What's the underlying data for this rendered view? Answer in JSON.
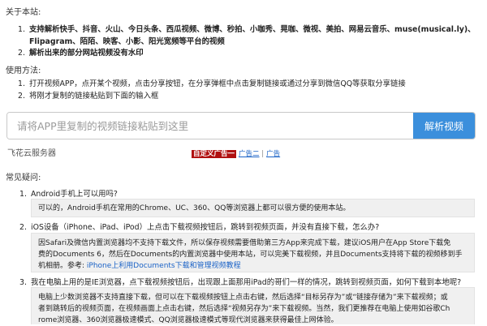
{
  "about": {
    "title": "关于本站:",
    "items": [
      {
        "num": "1.",
        "line1": "支持解析快手、抖音、火山、今日头条、西瓜视频、微博、秒拍、小咖秀、晃咖、微视、美拍、网易云音乐、muse(musical.ly)、",
        "line2": "Flipagram、陌陌、映客、小影、阳光宽频等平台的视频"
      },
      {
        "num": "2.",
        "line1": "解析出来的部分网站视频没有水印"
      }
    ]
  },
  "usage": {
    "title": "使用方法:",
    "items": [
      {
        "num": "1.",
        "text": "打开视频APP，点开某个视频，点击分享按钮，在分享弹框中点击复制链接或通过分享到微信QQ等获取分享链接"
      },
      {
        "num": "2.",
        "text": "将刚才复制的链接粘贴到下面的输入框"
      }
    ]
  },
  "search": {
    "placeholder": "请将APP里复制的视频链接粘贴到这里",
    "value": "",
    "button_label": "解析视频"
  },
  "brand": "飞花云服务器",
  "ads": {
    "ad1": "自定义广告一",
    "ad2": "广告二",
    "sep": "|",
    "ad3": "广告"
  },
  "faq": {
    "title": "常见疑问:",
    "items": [
      {
        "num": "1.",
        "question": "Android手机上可以用吗?",
        "answer": [
          "可以的，Android手机在常用的Chrome、UC、360、QQ等浏览器上都可以很方便的使用本站。"
        ]
      },
      {
        "num": "2.",
        "question": "iOS设备（iPhone、iPad、iPod）上点击下载视频按钮后，跳转到视频页面，并没有直接下载，怎么办?",
        "answer": [
          "因Safari及微信内置浏览器均不支持下载文件，所以保存视频需要借助第三方App来完成下载，建议iOS用户在App Store下载免",
          "费的Documents 6，然后在Documents的内置浏览器中使用本站，可以完美下载视频，并且Documents支持将下载的视频移到手",
          "机相册。参考:"
        ],
        "link": "iPhone上利用Documents下载和管理视频教程"
      },
      {
        "num": "3.",
        "question": "我在电脑上用的是IE浏览器，点下载视频按钮后，出现跟上面那用iPad的哥们一样的情况，跳转到视频页面，如何下载到本地呢?",
        "answer": [
          "电脑上少数浏览器不支持直接下载，但可以在下载视频按钮上点击右键，然后选择“目标另存为”或“链接存储为”来下载视频；或",
          "者到跳转后的视频页面，在视频画面上点击右键，然后选择“视频另存为”来下载视频。当然，我们更推荐在电脑上使用如谷歌Ch",
          "rome浏览器、360浏览器极速模式、QQ浏览器极速模式等现代浏览器来获得最佳上网体验。"
        ]
      }
    ]
  }
}
